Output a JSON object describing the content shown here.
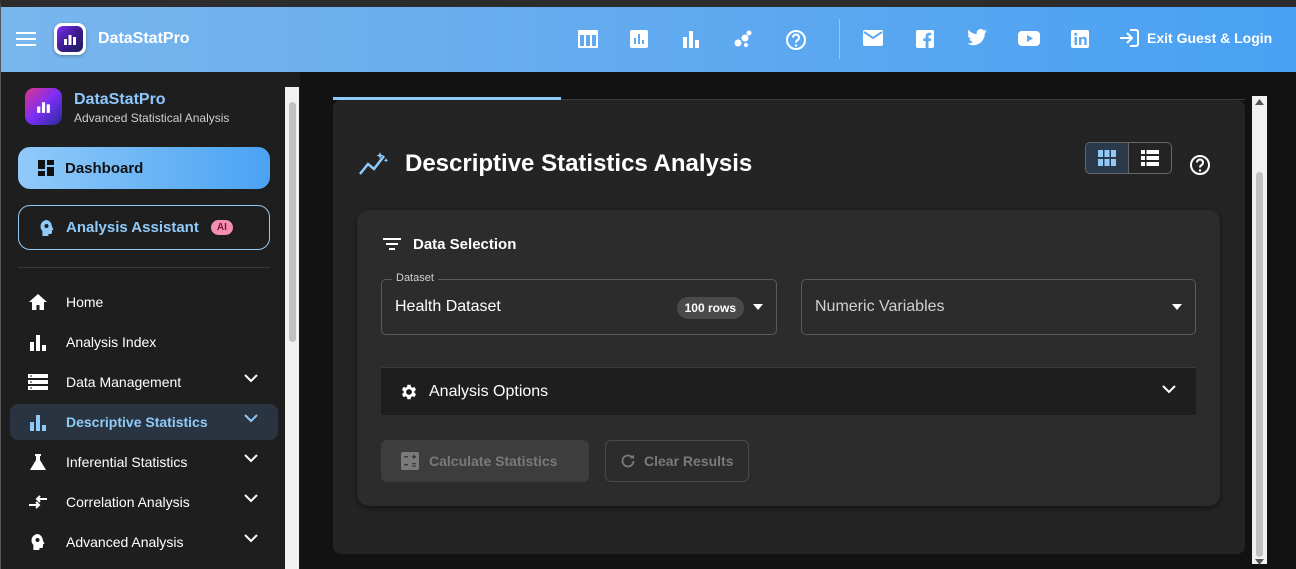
{
  "appbar": {
    "brand": "DataStatPro",
    "toolbar_icons": [
      "table-icon",
      "bar-chart-icon",
      "column-chart-icon",
      "scatter-icon",
      "help-icon"
    ],
    "social_icons": [
      "mail-icon",
      "facebook-icon",
      "twitter-icon",
      "youtube-icon",
      "linkedin-icon"
    ],
    "exit_label": "Exit Guest & Login"
  },
  "sidebar": {
    "title": "DataStatPro",
    "subtitle": "Advanced Statistical Analysis",
    "dashboard_label": "Dashboard",
    "assistant_label": "Analysis Assistant",
    "assistant_badge": "AI",
    "items": [
      {
        "label": "Home",
        "icon": "home-icon",
        "expandable": false
      },
      {
        "label": "Analysis Index",
        "icon": "bar-chart-icon",
        "expandable": false
      },
      {
        "label": "Data Management",
        "icon": "storage-icon",
        "expandable": true
      },
      {
        "label": "Descriptive Statistics",
        "icon": "bar-chart-icon",
        "expandable": true,
        "active": true
      },
      {
        "label": "Inferential Statistics",
        "icon": "flask-icon",
        "expandable": true
      },
      {
        "label": "Correlation Analysis",
        "icon": "compare-arrows-icon",
        "expandable": true
      },
      {
        "label": "Advanced Analysis",
        "icon": "psychology-icon",
        "expandable": true
      }
    ]
  },
  "main": {
    "title": "Descriptive Statistics Analysis",
    "card": {
      "title": "Data Selection",
      "dataset_label": "Dataset",
      "dataset_value": "Health Dataset",
      "rows_chip": "100 rows",
      "variables_placeholder": "Numeric Variables",
      "options_label": "Analysis Options",
      "calculate_label": "Calculate Statistics",
      "clear_label": "Clear Results"
    }
  },
  "colors": {
    "accent": "#90caf9",
    "appbar_start": "#79b6ee",
    "appbar_end": "#49a1f3",
    "surface": "#2c2c2c"
  }
}
